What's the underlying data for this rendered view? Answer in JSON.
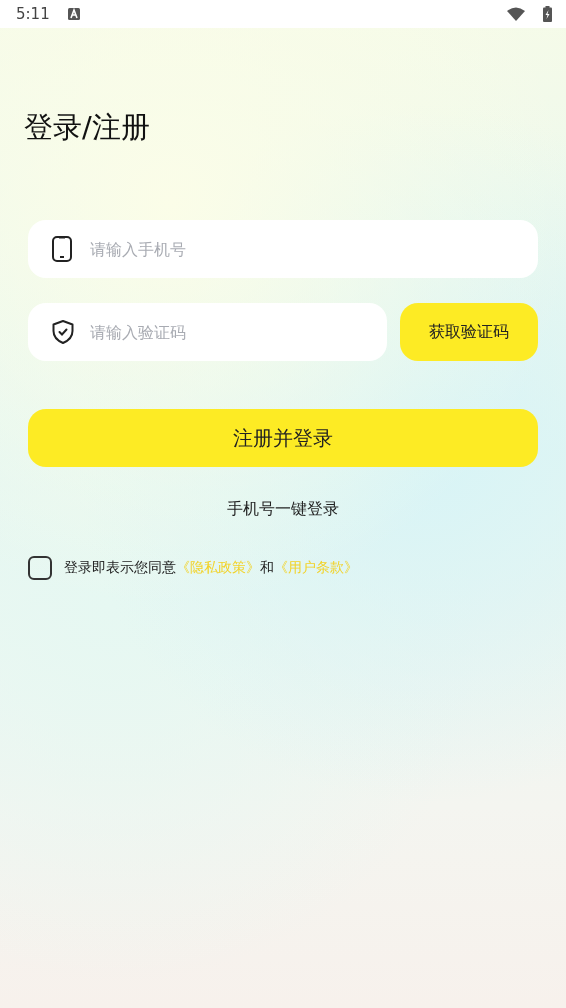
{
  "status_bar": {
    "time": "5:11"
  },
  "title": "登录/注册",
  "phone_field": {
    "placeholder": "请输入手机号"
  },
  "code_field": {
    "placeholder": "请输入验证码"
  },
  "get_code_button": "获取验证码",
  "submit_button": "注册并登录",
  "one_click_link": "手机号一键登录",
  "agreement": {
    "checked": false,
    "prefix": "登录即表示您同意",
    "privacy_link": "《隐私政策》",
    "joiner": "和",
    "terms_link": "《用户条款》"
  }
}
